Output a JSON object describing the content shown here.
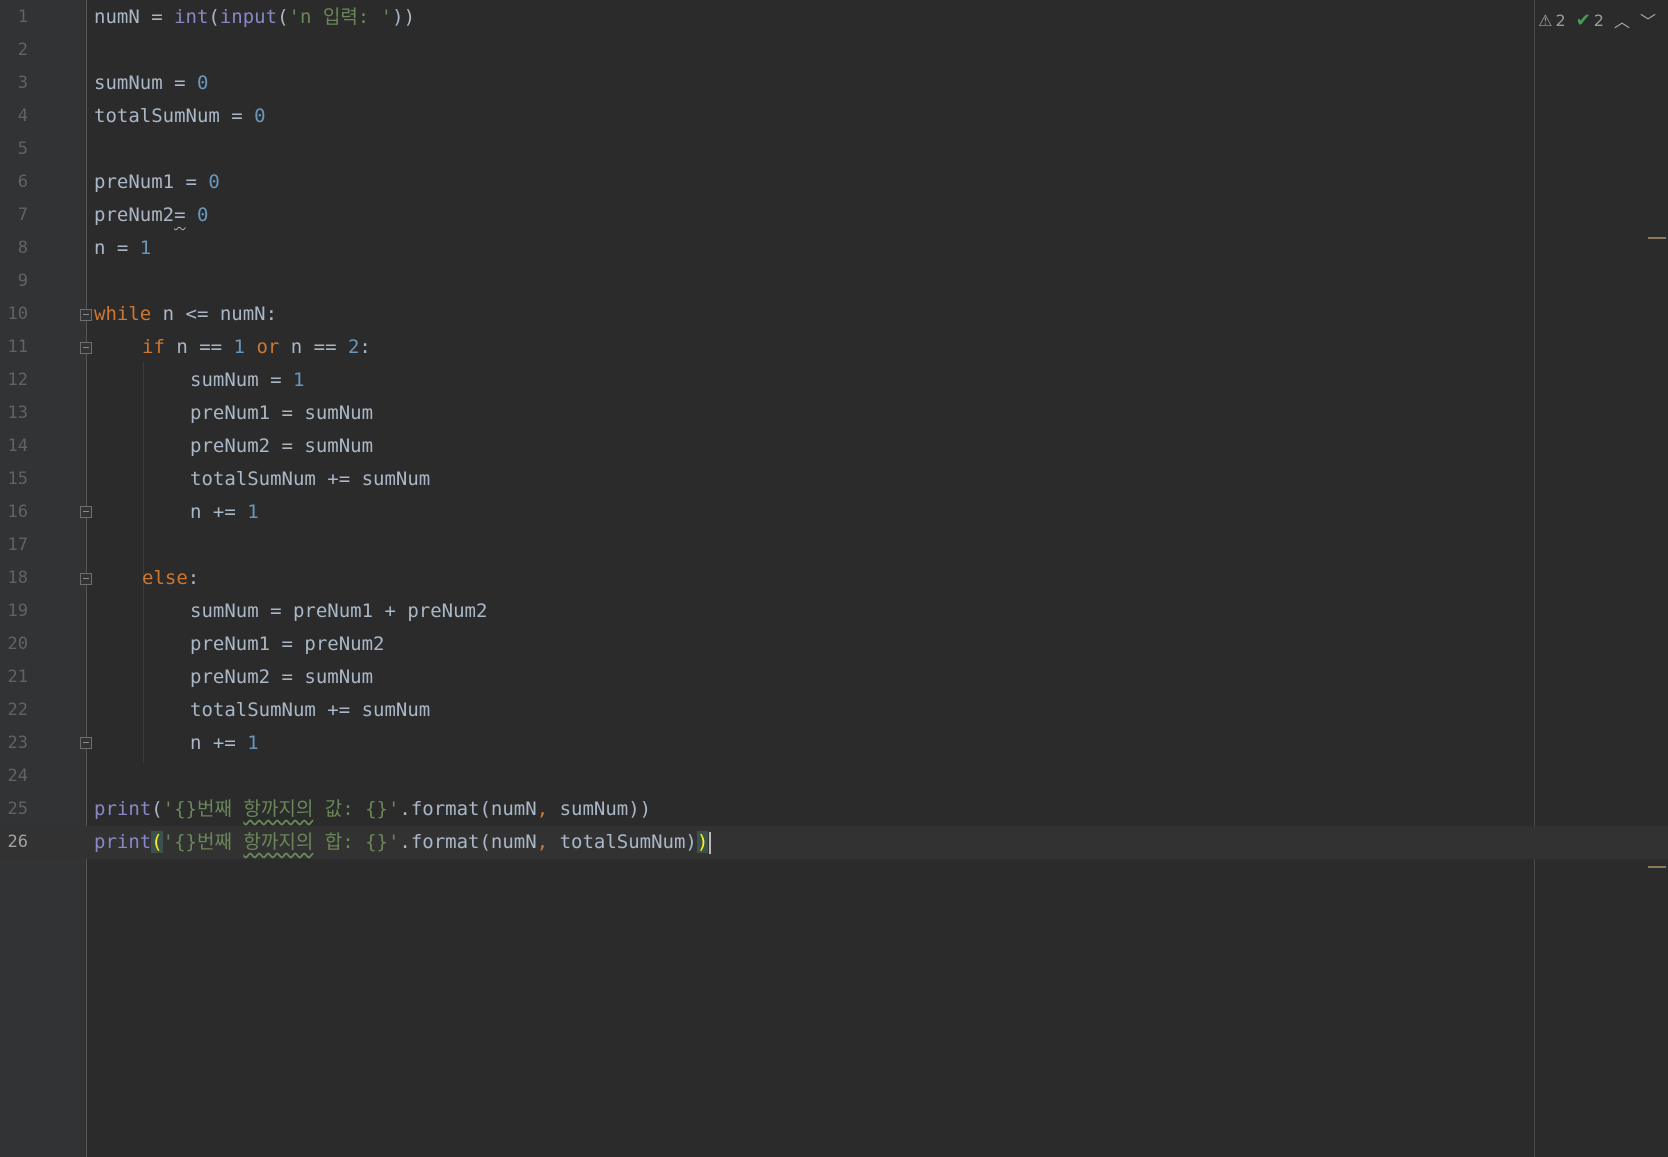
{
  "editor": {
    "status": {
      "warnings": "2",
      "typos": "2"
    },
    "lines": [
      {
        "n": "1"
      },
      {
        "n": "2"
      },
      {
        "n": "3"
      },
      {
        "n": "4"
      },
      {
        "n": "5"
      },
      {
        "n": "6"
      },
      {
        "n": "7"
      },
      {
        "n": "8"
      },
      {
        "n": "9"
      },
      {
        "n": "10"
      },
      {
        "n": "11"
      },
      {
        "n": "12"
      },
      {
        "n": "13"
      },
      {
        "n": "14"
      },
      {
        "n": "15"
      },
      {
        "n": "16"
      },
      {
        "n": "17"
      },
      {
        "n": "18"
      },
      {
        "n": "19"
      },
      {
        "n": "20"
      },
      {
        "n": "21"
      },
      {
        "n": "22"
      },
      {
        "n": "23"
      },
      {
        "n": "24"
      },
      {
        "n": "25"
      },
      {
        "n": "26"
      }
    ],
    "code": {
      "l1_a": "numN = ",
      "l1_int": "int",
      "l1_b": "(",
      "l1_input": "input",
      "l1_c": "(",
      "l1_str": "'n 입력: '",
      "l1_d": "))",
      "l3_a": "sumNum = ",
      "l3_num": "0",
      "l4_a": "totalSumNum = ",
      "l4_num": "0",
      "l6_a": "preNum1 = ",
      "l6_num": "0",
      "l7_a": "preNum2",
      "l7_eq": "=",
      "l7_b": " ",
      "l7_num": "0",
      "l8_a": "n = ",
      "l8_num": "1",
      "l10_kw": "while",
      "l10_a": " n <= numN:",
      "l11_kw1": "if",
      "l11_a": " n == ",
      "l11_n1": "1",
      "l11_sp": " ",
      "l11_kw2": "or",
      "l11_b": " n == ",
      "l11_n2": "2",
      "l11_c": ":",
      "l12_a": "sumNum = ",
      "l12_num": "1",
      "l13": "preNum1 = sumNum",
      "l14": "preNum2 = sumNum",
      "l15": "totalSumNum += sumNum",
      "l16_a": "n += ",
      "l16_num": "1",
      "l18_kw": "else",
      "l18_a": ":",
      "l19": "sumNum = preNum1 + preNum2",
      "l20": "preNum1 = preNum2",
      "l21": "preNum2 = sumNum",
      "l22": "totalSumNum += sumNum",
      "l23_a": "n += ",
      "l23_num": "1",
      "l25_print": "print",
      "l25_a": "(",
      "l25_s1": "'{}번째 ",
      "l25_s2": "항까지의",
      "l25_s3": " 값: {}'",
      "l25_b": ".format(numN",
      "l25_comma": ",",
      "l25_c": " sumNum))",
      "l26_print": "print",
      "l26_a": "(",
      "l26_s1": "'{}번째 ",
      "l26_s2": "항까지의",
      "l26_s3": " 합: {}'",
      "l26_b": ".format(numN",
      "l26_comma": ",",
      "l26_c": " totalSumNum)",
      "l26_d": ")"
    }
  }
}
